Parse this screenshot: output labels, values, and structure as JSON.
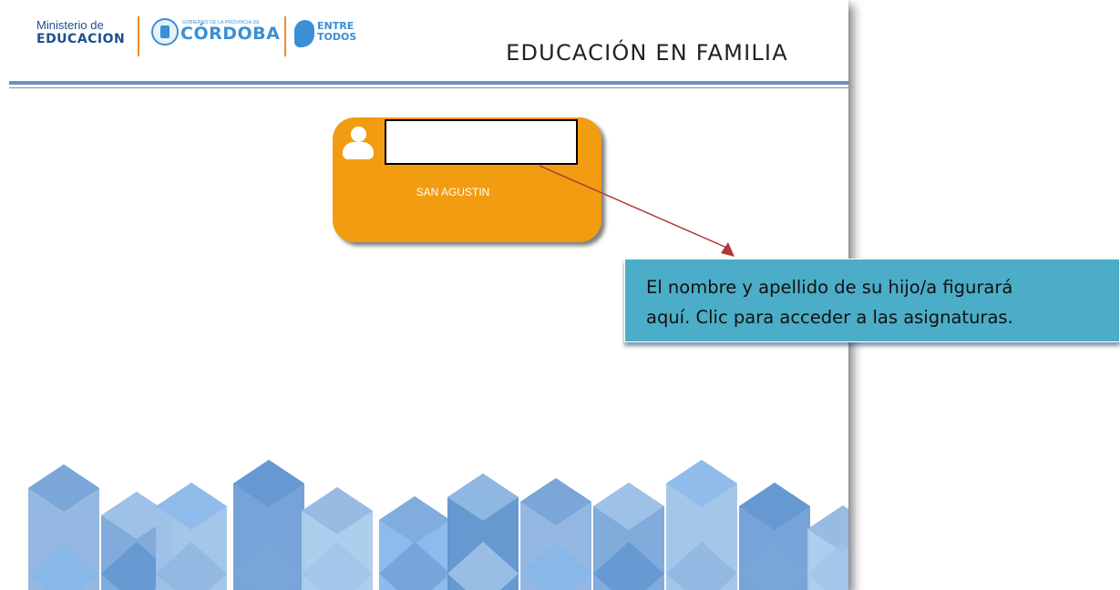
{
  "header": {
    "logo_ministerio_small": "Ministerio de",
    "logo_ministerio_big": "EDUCACION",
    "logo_cordoba_govt": "GOBIERNO DE LA PROVINCIA DE",
    "logo_cordoba_name": "CÓRDOBA",
    "logo_entre_line1": "ENTRE",
    "logo_entre_line2": "TODOS",
    "title": "EDUCACIÓN EN FAMILIA"
  },
  "student_card": {
    "school": "SAN AGUSTIN",
    "student_name": ""
  },
  "callout": {
    "text": "El nombre y apellido de su hijo/a figurará\naquí.  Clic para acceder a las asignaturas."
  },
  "colors": {
    "card": "#f29c11",
    "rule": "#6d8fc4",
    "callout": "#4badc7",
    "arrow": "#b03a3a",
    "brand_blue": "#3a8fd6"
  },
  "icons": {
    "avatar": "user-avatar-icon"
  }
}
